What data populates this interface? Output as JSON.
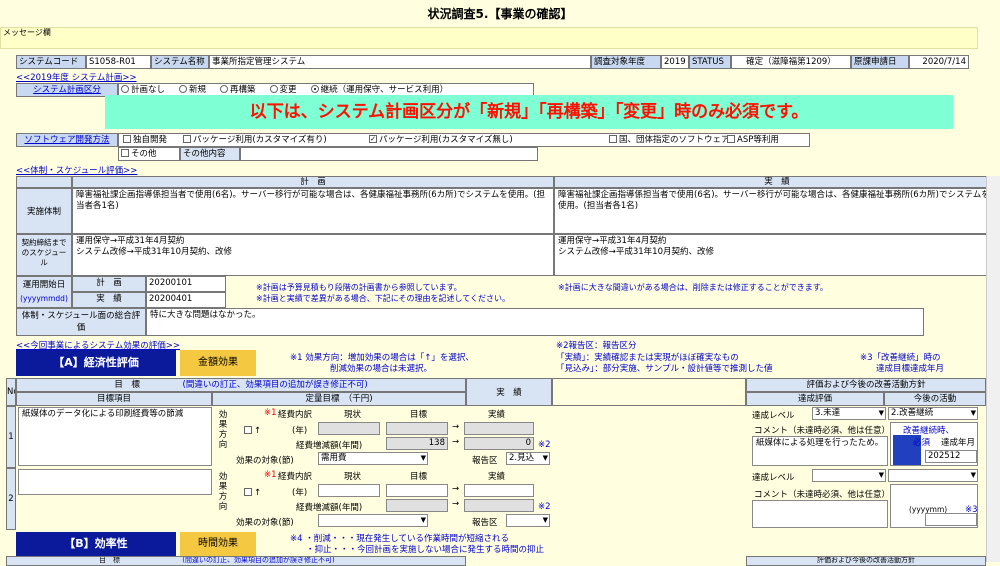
{
  "page_title": "状況調査5.【事業の確認】",
  "message_label": "メッセージ欄",
  "system_row": {
    "code_label": "システムコード",
    "code_value": "S1058-R01",
    "name_label": "システム名称",
    "name_value": "事業所指定管理システム",
    "year_label": "調査対象年度",
    "year_value": "2019",
    "status_label": "STATUS",
    "status_value": "確定（滋障福第1209）",
    "date_label": "原課申請日",
    "date_value": "2020/7/14"
  },
  "plan_section_link": "<<2019年度 システム計画>>",
  "plan_kubun": {
    "label": "システム計画区分",
    "options": [
      "計画なし",
      "新規",
      "再構築",
      "変更",
      "継続（運用保守、サービス利用）"
    ],
    "selected_index": 4
  },
  "banner_text": "以下は、システム計画区分が「新規」「再構築」「変更」時のみ必須です。",
  "software": {
    "label": "ソフトウェア開発方法",
    "options": [
      {
        "label": "独自開発",
        "checked": false
      },
      {
        "label": "パッケージ利用(カスタマイズ有り)",
        "checked": false
      },
      {
        "label": "パッケージ利用(カスタマイズ無し)",
        "checked": true
      },
      {
        "label": "国、団体指定のソフトウェア",
        "checked": false
      },
      {
        "label": "ASP等利用",
        "checked": false
      },
      {
        "label": "その他",
        "checked": false
      }
    ],
    "other_label": "その他内容",
    "other_value": ""
  },
  "schedule_link": "<<体制・スケジュール評価>>",
  "schedule": {
    "plan_header": "計　画",
    "actual_header": "実　績",
    "jisshi_label": "実施体制",
    "jisshi_plan": "障害福祉課企画指導係担当者で使用(6名)。サーバー移行が可能な場合は、各健康福祉事務所(6カ所)でシステムを使用。(担当者各1名)",
    "jisshi_actual": "障害福祉課企画指導係担当者で使用(6名)。サーバー移行が可能な場合は、各健康福祉事務所(6カ所)でシステムを使用。(担当者各1名)",
    "keiyaku_label": "契約締結までのスケジュール",
    "keiyaku_plan": "運用保守→平成31年4月契約\nシステム改修→平成31年10月契約、改修",
    "keiyaku_actual": "運用保守→平成31年4月契約\nシステム改修→平成31年10月契約、改修",
    "start_label": "運用開始日",
    "start_sub": "(yyyymmdd)",
    "start_plan_label": "計　画",
    "start_plan_value": "20200101",
    "start_actual_label": "実　績",
    "start_actual_value": "20200401",
    "note1": "※計画は予算見積もり段階の計画書から参照しています。",
    "note2": "※計画に大きな間違いがある場合は、削除または修正することができます。",
    "note3": "※計画と実績で差異がある場合、下記にその理由を記述してください。",
    "sougou_label": "体制・スケジュール面の総合評価",
    "sougou_value": "特に大きな問題はなかった。"
  },
  "effect_link": "<<今回事業によるシステム効果の評価>>",
  "report_note_a": "※2報告区：報告区分",
  "report_note_b": "「実績」：実績確認または実現がほぼ確実なもの",
  "report_note_c": "「見込み」：部分実施、サンプル・設計値等で推測した値",
  "kaizen_note_a": "※3「改善継続」時の",
  "kaizen_note_b": "達成目標達成年月",
  "section_a": {
    "title": "【A】経済性評価",
    "tag": "金額効果",
    "note1": "※1 効果方向：増加効果の場合は「↑」を選択、",
    "note2": "削減効果の場合は未選択。"
  },
  "table_head": {
    "no": "No",
    "mokuhyo": "目　標",
    "mokuhyo_sub": "(間違いの訂正、効果項目の追加が誤き修正不可)",
    "jisseki": "実　績",
    "hyoka": "評価および今後の改善活動方針",
    "koumoku": "目標項目",
    "teiryo": "定量目標　（千円)",
    "tassei": "達成評価",
    "kongo": "今後の活動"
  },
  "rows": [
    {
      "no": "1",
      "item": "紙媒体のデータ化による印刷経費等の節減",
      "kouka_label": "効果方向",
      "arrow": "↑",
      "keihi_label": "経費内訳",
      "nen_label": "(年)",
      "genjo_label": "現状",
      "mokuhyo_label": "目標",
      "jisseki_label": "実績",
      "zougen_label": "経費増減額(年間)",
      "zougen_target": "138",
      "zougen_actual": "0",
      "taisho_label": "効果の対象(節)",
      "taisho_value": "需用費",
      "houkoku_label": "報告区",
      "houkoku_value": "2.見込",
      "tassei_label": "達成レベル",
      "tassei_value": "3.未達",
      "kongo_value": "2.改善継続",
      "comment_label": "コメント（未達時必須、他は任意）",
      "comment_value": "紙媒体による処理を行ったため。",
      "kaizen_label": "改善継続時、",
      "hissu": "必須",
      "tassei_ym_label": "達成年月",
      "tassei_ym_value": "202512"
    },
    {
      "no": "2",
      "item": "",
      "kouka_label": "効果方向",
      "arrow": "↑",
      "keihi_label": "経費内訳",
      "nen_label": "(年)",
      "genjo_label": "現状",
      "mokuhyo_label": "目標",
      "jisseki_label": "実績",
      "zougen_label": "経費増減額(年間)",
      "taisho_label": "効果の対象(節)",
      "houkoku_label": "報告区",
      "tassei_label": "達成レベル",
      "comment_label": "コメント（未達時必須、他は任意）",
      "ym_hint": "(yyyymm)",
      "note3": "※3"
    }
  ],
  "section_b": {
    "title": "【B】効率性",
    "tag": "時間効果",
    "note1": "※4 ・削減・・・現在発生している作業時間が短縮される",
    "note2": "・抑止・・・今回計画を実施しない場合に発生する時間の抑止"
  },
  "bottom_cut": {
    "mokuhyo": "目　標",
    "sub": "(間違いの訂正、効果項目の追加が誤き修正不可)",
    "hyoka": "評価および今後の改善活動方針"
  },
  "colors": {
    "banner_bg": "#7fffd4",
    "banner_text": "#ff1000",
    "header_blue": "#0a1a9a",
    "tag_gold": "#f5c842",
    "page_bg": "#ffffe0"
  }
}
